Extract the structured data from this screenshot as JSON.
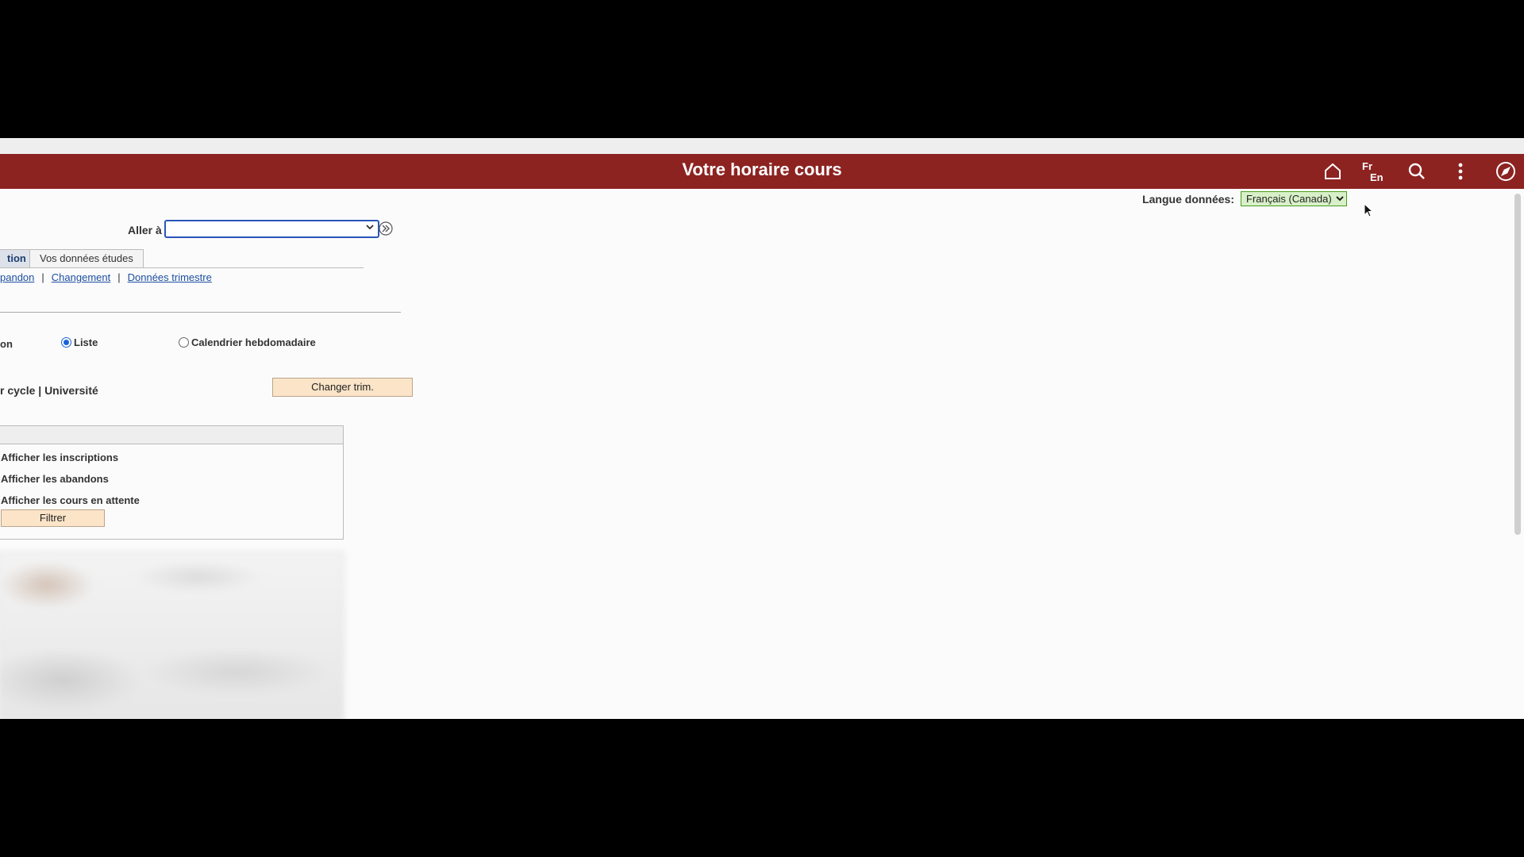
{
  "header": {
    "title": "Votre horaire cours",
    "icons": [
      "home-icon",
      "language-toggle-icon",
      "search-icon",
      "more-vert-icon",
      "compass-icon"
    ]
  },
  "language": {
    "label": "Langue données:",
    "selected": "Français (Canada)"
  },
  "goto": {
    "label": "Aller à",
    "value": ""
  },
  "tabs": [
    {
      "label": "tion",
      "active": true
    },
    {
      "label": "Vos données études",
      "active": false
    }
  ],
  "sublinks": {
    "abandon": "pandon",
    "change": "Changement",
    "term_data": "Données trimestre"
  },
  "view": {
    "label_cut": "on",
    "list_label": "Liste",
    "calendar_label": "Calendrier hebdomadaire",
    "selected": "Liste"
  },
  "term": {
    "text": "r cycle | Université",
    "change_button": "Changer trim."
  },
  "filters": {
    "items": [
      "Afficher les inscriptions",
      "Afficher les abandons",
      "Afficher les cours en attente"
    ],
    "button": "Filtrer"
  },
  "colors": {
    "banner": "#8c2321",
    "button_bg": "#fbe4c8",
    "link": "#1d4fa0",
    "lang_select_bg": "#d8f0c8"
  }
}
